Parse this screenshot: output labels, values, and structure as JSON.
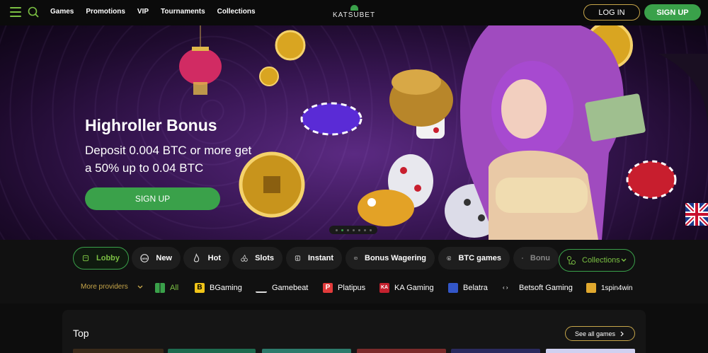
{
  "header": {
    "nav": [
      "Games",
      "Promotions",
      "VIP",
      "Tournaments",
      "Collections"
    ],
    "logo_text": "KATSUBET",
    "login_label": "LOG IN",
    "signup_label": "SIGN UP"
  },
  "hero": {
    "title": "Highroller Bonus",
    "subtitle": "Deposit 0.004 BTC or more get a 50% up to 0.04 BTC",
    "cta_label": "SIGN UP",
    "carousel_active": 2,
    "carousel_count": 7
  },
  "categories": [
    "Lobby",
    "New",
    "Hot",
    "Slots",
    "Instant",
    "Bonus Wagering",
    "BTC games",
    "Bonu"
  ],
  "collections_label": "Collections",
  "providers": {
    "more_label": "More providers",
    "items": [
      "All",
      "BGaming",
      "Gamebeat",
      "Platipus",
      "KA Gaming",
      "Belatra",
      "Betsoft Gaming",
      "1spin4win"
    ]
  },
  "top_section": {
    "title": "Top",
    "see_all_label": "See all games"
  },
  "colors": {
    "accent_green": "#3aa14a",
    "gold_border": "#c7a64a",
    "background": "#0d0d0d"
  }
}
